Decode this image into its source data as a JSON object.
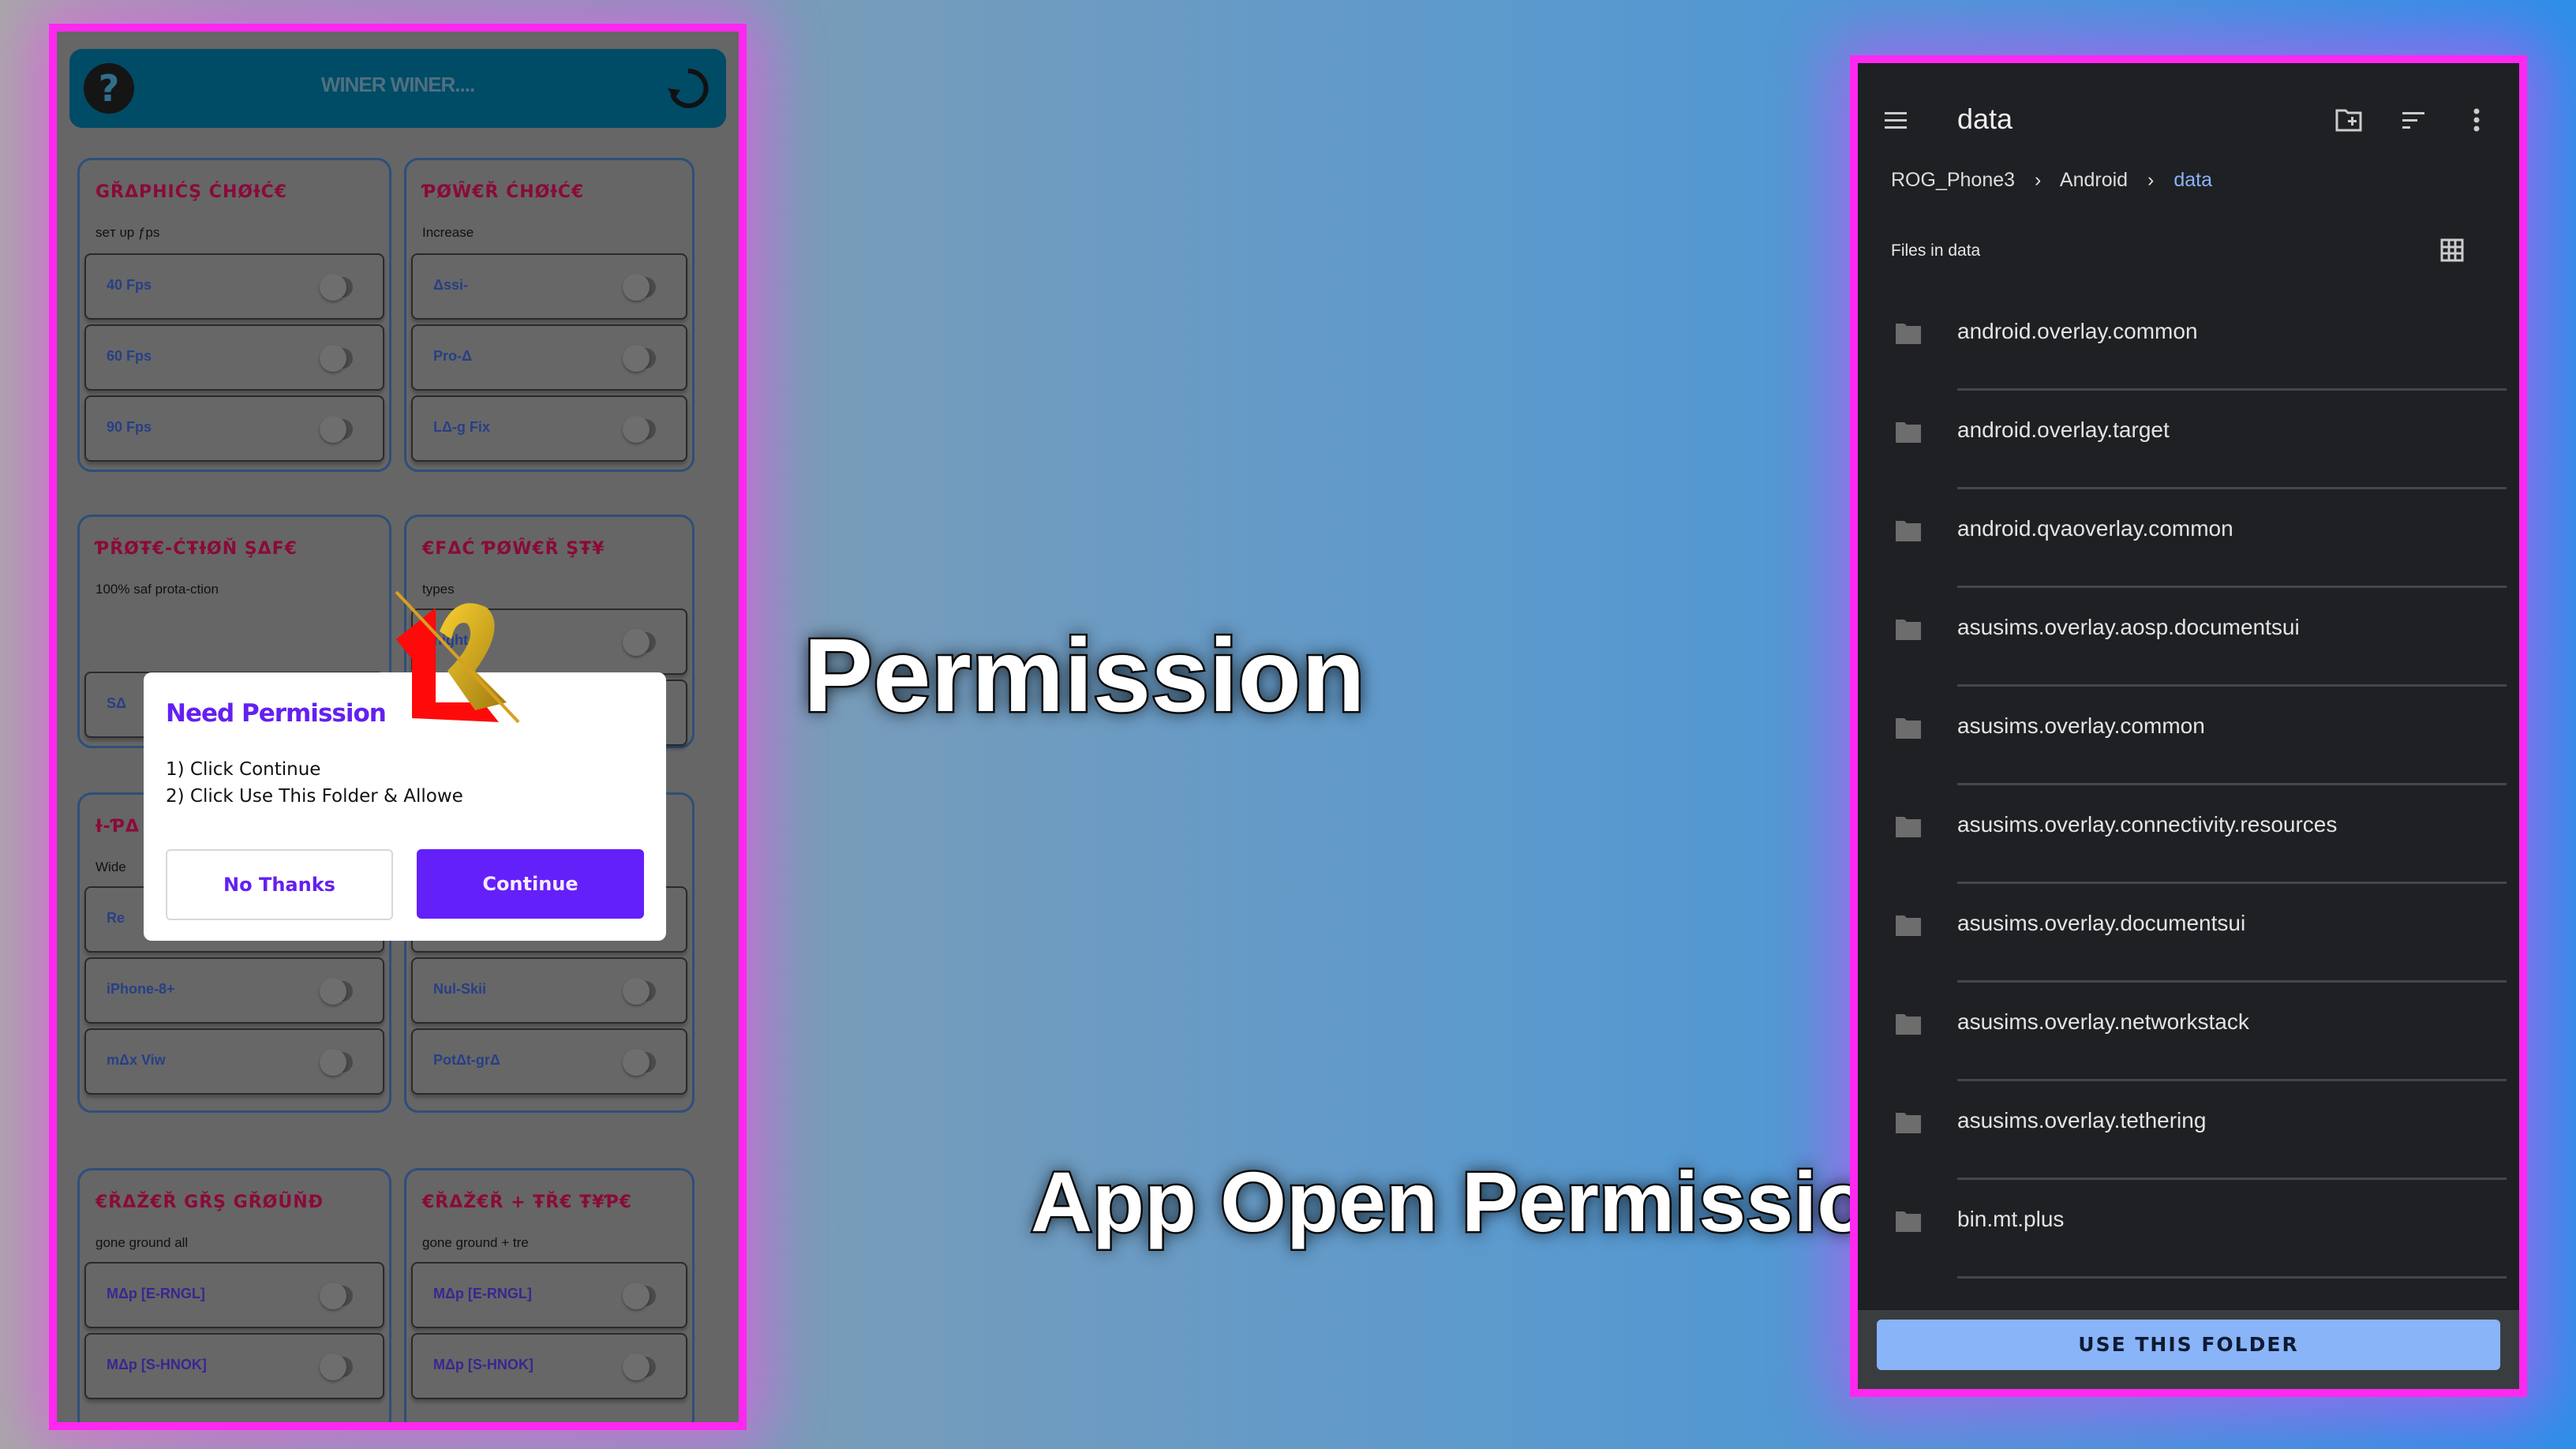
{
  "left_app": {
    "title": "WINER WINER....",
    "cards": [
      {
        "title": "GŘΔPHIĆŞ ĆHØƗĆ€",
        "subtitle": "seт υp ƒps",
        "rows": [
          {
            "label": "40 Fps",
            "on": false
          },
          {
            "label": "60 Fps",
            "on": false
          },
          {
            "label": "90 Fps",
            "on": false
          }
        ]
      },
      {
        "title": "ƤØŴ€Ř ĆHØƗĆ€",
        "subtitle": "Increase",
        "rows": [
          {
            "label": "Δssi-",
            "on": false
          },
          {
            "label": "Pro-Δ",
            "on": false
          },
          {
            "label": "LΔ-g Fix",
            "on": false
          }
        ]
      },
      {
        "title": "ƤŘØŦ€-ĆŦƗØŇ ŞΔF€",
        "subtitle": "100% saf prota-ction",
        "rows": [
          {
            "label": "SΔ",
            "on": false
          }
        ]
      },
      {
        "title": "€FΔĆ ƤØŴ€Ř ŞŦ¥",
        "subtitle": "types",
        "rows": [
          {
            "label": "night",
            "on": false
          },
          {
            "label": "",
            "on": false
          }
        ]
      },
      {
        "title": "Ɨ-ƤΔ",
        "subtitle": "Wide",
        "rows": [
          {
            "label": "Re",
            "on": false
          },
          {
            "label": "iPhone-8+",
            "on": false
          },
          {
            "label": "mΔx Viw",
            "on": false
          }
        ]
      },
      {
        "title": "",
        "subtitle": "",
        "rows": [
          {
            "label": "",
            "on": false
          },
          {
            "label": "Nul-Skii",
            "on": false
          },
          {
            "label": "PotΔt-grΔ",
            "on": false
          }
        ]
      },
      {
        "title": "€ŘΔŽ€Ř GŘŞ GŘØŨŇĐ",
        "subtitle": "gone ground all",
        "rows": [
          {
            "label": "MΔp [E-RNGL]",
            "on": false
          },
          {
            "label": "MΔp [S-HNOK]",
            "on": false
          }
        ]
      },
      {
        "title": "€ŘΔŽ€Ř + ŦŘ€ Ŧ¥Ƥ€",
        "subtitle": "gone ground + tre",
        "rows": [
          {
            "label": "MΔp [E-RNGL]",
            "on": false
          },
          {
            "label": "MΔp [S-HNOK]",
            "on": false
          }
        ]
      }
    ],
    "dialog": {
      "title": "Need Permission",
      "line1": "1) Click Continue",
      "line2": "2) Click Use This Folder & Allowe",
      "no_label": "No Thanks",
      "continue_label": "Continue"
    },
    "badge_number": "12"
  },
  "headlines": {
    "permission": "Permission",
    "app_open": "App Open Permission"
  },
  "file_picker": {
    "title": "data",
    "breadcrumb": [
      "ROG_Phone3",
      "Android",
      "data"
    ],
    "section_label": "Files in data",
    "files": [
      "android.overlay.common",
      "android.overlay.target",
      "android.qvaoverlay.common",
      "asusims.overlay.aosp.documentsui",
      "asusims.overlay.common",
      "asusims.overlay.connectivity.resources",
      "asusims.overlay.documentsui",
      "asusims.overlay.networkstack",
      "asusims.overlay.tethering",
      "bin.mt.plus"
    ],
    "use_folder_label": "USE THIS FOLDER"
  },
  "colors": {
    "frame": "#ff28f0",
    "accent_purple": "#6420f8",
    "picker_accent": "#8ab4f8",
    "appbar": "#004b66"
  }
}
